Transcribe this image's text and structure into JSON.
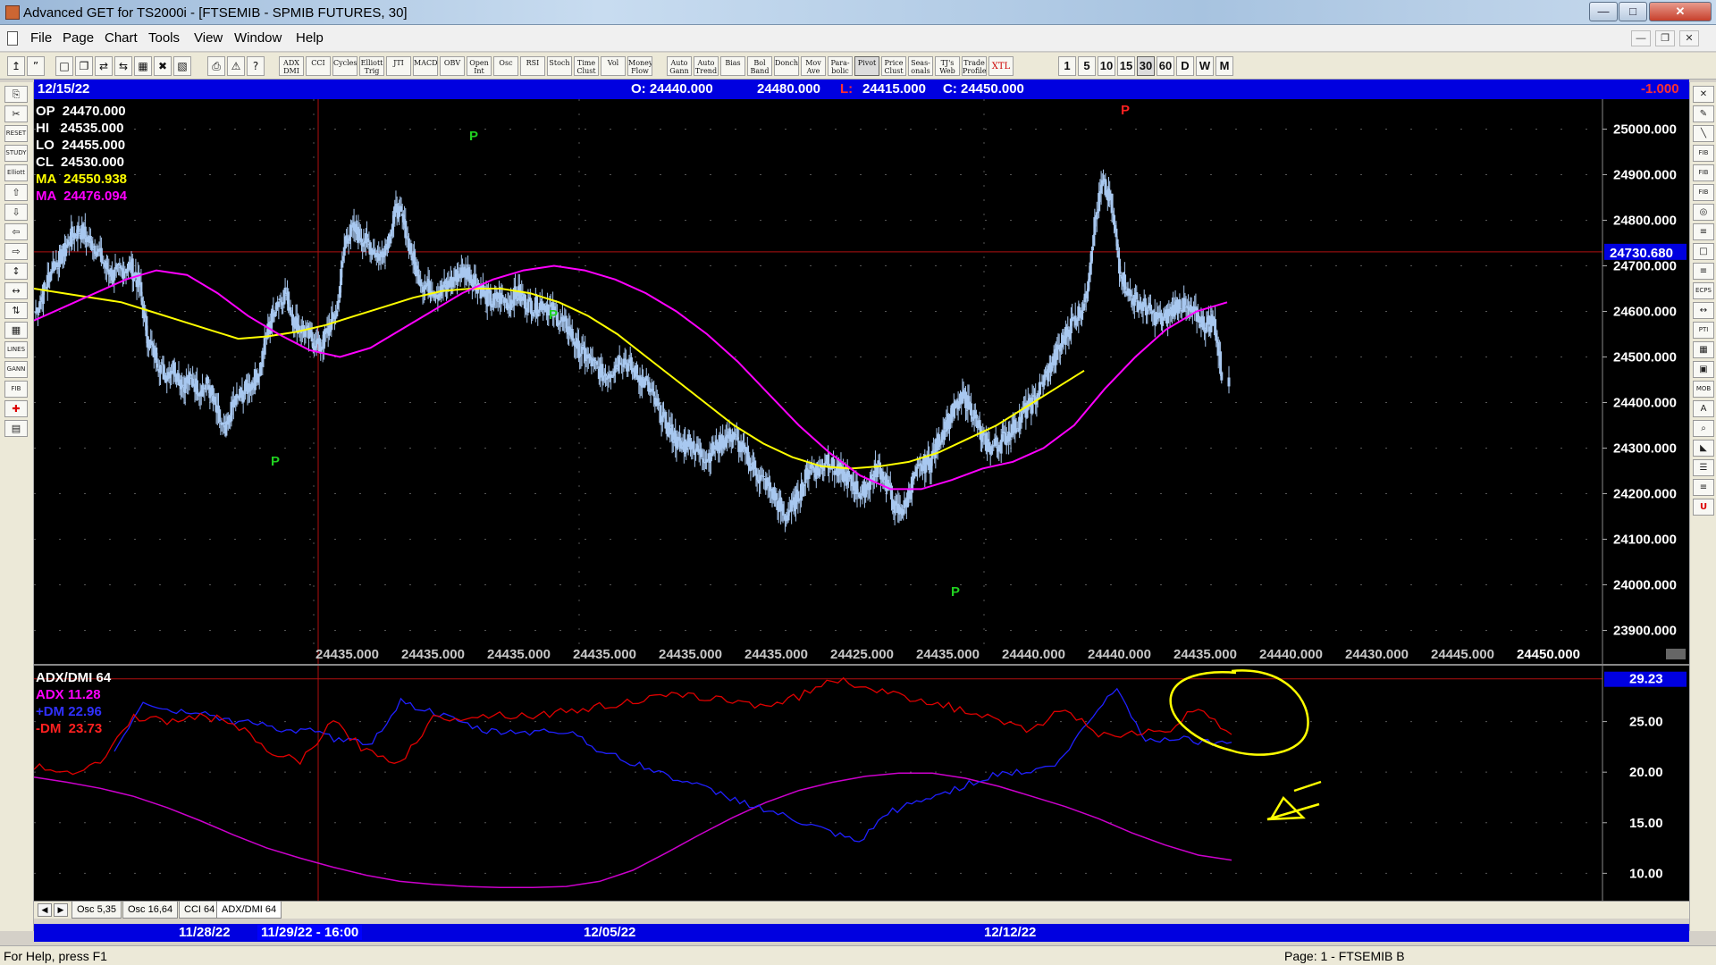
{
  "window": {
    "title": "Advanced GET for TS2000i - [FTSEMIB - SPMIB FUTURES, 30]",
    "controls": {
      "minimize": "—",
      "maximize": "□",
      "close": "✕"
    }
  },
  "menu": [
    "File",
    "Page",
    "Chart",
    "Tools",
    "View",
    "Window",
    "Help"
  ],
  "toolbar": {
    "study_buttons": [
      "ADX DMI",
      "CCI",
      "Cycles",
      "Elliott Trig",
      "JTI",
      "MACD",
      "OBV",
      "Open Int",
      "Osc",
      "RSI",
      "Stoch",
      "Time Clust",
      "Vol",
      "Money Flow",
      "Auto Gann",
      "Auto Trend",
      "Bias",
      "Bol Band",
      "Donch",
      "Mov Ave",
      "Para-bolic",
      "Pivot",
      "Price Clust",
      "Seas-onals",
      "TJ's Web",
      "Trade Profile",
      "XTL"
    ],
    "periods": [
      "1",
      "5",
      "10",
      "15",
      "30",
      "60",
      "D",
      "W",
      "M"
    ],
    "selected_period": "30"
  },
  "lefttools": [
    "",
    "",
    "RESET",
    "STUDY",
    "Elliott",
    "",
    "",
    "",
    "",
    "",
    "",
    "",
    "",
    "LINES",
    "GANN",
    "FIB",
    "",
    ""
  ],
  "righttools": [
    "",
    "",
    "",
    "FIB RET",
    "FIB EXT",
    "FIB TIME",
    "",
    "",
    "",
    "",
    "ECPS",
    "",
    "PTI",
    "",
    "",
    "MOB",
    "A",
    "",
    "",
    "",
    "",
    "U"
  ],
  "infobar": {
    "date": "12/15/22",
    "open": "O: 24440.000",
    "high": "24480.000",
    "low_label": "L:",
    "low": "24415.000",
    "close": "C: 24450.000",
    "change": "-1.000"
  },
  "price_readout": {
    "op": "OP  24470.000",
    "hi": "HI   24535.000",
    "lo": "LO  24455.000",
    "cl": "CL  24530.000",
    "ma1": "MA  24550.938",
    "ma2": "MA  24476.094"
  },
  "price_axis": {
    "labels": [
      "25000.000",
      "24900.000",
      "24800.000",
      "24700.000",
      "24600.000",
      "24500.000",
      "24400.000",
      "24300.000",
      "24200.000",
      "24100.000",
      "24000.000",
      "23900.000"
    ],
    "highlight": "24730.680"
  },
  "mid_values": [
    "24435.000",
    "24435.000",
    "24435.000",
    "24435.000",
    "24435.000",
    "24435.000",
    "24425.000",
    "24435.000",
    "24440.000",
    "24440.000",
    "24435.000",
    "24440.000",
    "24430.000",
    "24445.000",
    "24450.000"
  ],
  "pivot_label": "P",
  "osc_readout": {
    "title": "ADX/DMI 64",
    "adx": "ADX 11.28",
    "plus_dm": "+DM 22.96",
    "minus_dm": "-DM  23.73"
  },
  "osc_axis": {
    "labels": [
      "25.00",
      "20.00",
      "15.00",
      "10.00"
    ],
    "highlight": "29.23"
  },
  "tabs": [
    "Osc 5,35",
    "Osc 16,64",
    "CCI 64",
    "ADX/DMI 64"
  ],
  "active_tab": "ADX/DMI 64",
  "datebar": {
    "d1": "11/28/22",
    "cursor": "11/29/22 - 16:00",
    "d2": "12/05/22",
    "d3": "12/12/22"
  },
  "status": {
    "left": "For Help, press F1",
    "right": "Page: 1 - FTSEMIB B"
  },
  "colors": {
    "bar": "#a8c8f0",
    "ma_fast": "#ffff00",
    "ma_slow": "#ff00ff",
    "adx": "#cc00cc",
    "plus_dm": "#2020ff",
    "minus_dm": "#e00000",
    "pivot_high": "#ff2020",
    "pivot_low": "#20d020"
  },
  "chart_data": {
    "type": "candlestick",
    "title": "FTSEMIB - SPMIB FUTURES, 30",
    "ylim": [
      23850,
      25050
    ],
    "x_labels": [
      "11/28/22",
      "12/05/22",
      "12/12/22"
    ],
    "close_path": [
      24600,
      24650,
      24700,
      24720,
      24760,
      24780,
      24760,
      24740,
      24700,
      24680,
      24690,
      24700,
      24660,
      24540,
      24500,
      24460,
      24480,
      24440,
      24450,
      24430,
      24440,
      24380,
      24330,
      24400,
      24420,
      24440,
      24470,
      24560,
      24620,
      24640,
      24580,
      24560,
      24540,
      24520,
      24560,
      24600,
      24760,
      24780,
      24760,
      24740,
      24720,
      24760,
      24830,
      24780,
      24700,
      24660,
      24650,
      24640,
      24660,
      24680,
      24690,
      24670,
      24640,
      24620,
      24630,
      24620,
      24640,
      24620,
      24610,
      24620,
      24600,
      24580,
      24560,
      24520,
      24500,
      24480,
      24460,
      24470,
      24500,
      24480,
      24460,
      24440,
      24400,
      24360,
      24330,
      24300,
      24320,
      24290,
      24280,
      24300,
      24320,
      24330,
      24300,
      24270,
      24240,
      24220,
      24190,
      24150,
      24170,
      24210,
      24260,
      24250,
      24280,
      24250,
      24240,
      24220,
      24200,
      24230,
      24260,
      24220,
      24160,
      24170,
      24230,
      24260,
      24270,
      24320,
      24360,
      24390,
      24410,
      24380,
      24320,
      24300,
      24310,
      24330,
      24350,
      24380,
      24400,
      24440,
      24480,
      24520,
      24560,
      24590,
      24620,
      24780,
      24880,
      24840,
      24700,
      24640,
      24620,
      24610,
      24590,
      24580,
      24600,
      24620,
      24600,
      24590,
      24570,
      24580,
      24440
    ],
    "ma_fast": [
      24650,
      24640,
      24630,
      24620,
      24600,
      24580,
      24560,
      24540,
      24545,
      24555,
      24570,
      24590,
      24610,
      24630,
      24645,
      24650,
      24650,
      24640,
      24620,
      24590,
      24550,
      24500,
      24450,
      24400,
      24350,
      24310,
      24280,
      24260,
      24255,
      24260,
      24270,
      24290,
      24320,
      24350,
      24390,
      24430,
      24470
    ],
    "ma_slow": [
      24580,
      24610,
      24640,
      24670,
      24690,
      24680,
      24640,
      24590,
      24550,
      24515,
      24500,
      24520,
      24560,
      24600,
      24640,
      24670,
      24690,
      24700,
      24690,
      24670,
      24640,
      24600,
      24550,
      24490,
      24420,
      24350,
      24290,
      24240,
      24210,
      24210,
      24230,
      24255,
      24270,
      24300,
      24350,
      24430,
      24500,
      24560,
      24600,
      24620
    ],
    "pivots": [
      {
        "label": "P",
        "kind": "low"
      },
      {
        "label": "P",
        "kind": "high"
      },
      {
        "label": "P",
        "kind": "low"
      },
      {
        "label": "P",
        "kind": "low"
      },
      {
        "label": "P",
        "kind": "high"
      }
    ],
    "oscillator": {
      "name": "ADX/DMI 64",
      "ylim": [
        8,
        30
      ],
      "adx": [
        19.5,
        19.0,
        18.4,
        17.6,
        16.5,
        15.2,
        13.8,
        12.5,
        11.5,
        10.6,
        9.8,
        9.2,
        8.9,
        8.7,
        8.6,
        8.6,
        8.7,
        9.2,
        10.3,
        12.0,
        13.8,
        15.5,
        17.0,
        18.2,
        19.0,
        19.6,
        19.9,
        19.9,
        19.4,
        18.6,
        17.6,
        16.6,
        15.4,
        14.0,
        12.8,
        11.8,
        11.3
      ],
      "plus_dm": [
        22,
        27,
        26,
        26,
        25,
        25,
        24,
        24,
        23,
        23,
        27,
        26,
        25,
        24,
        24,
        24,
        24,
        22,
        21,
        20,
        19,
        18,
        17,
        16,
        15,
        14,
        13,
        16,
        17,
        18,
        19,
        20,
        20,
        21,
        25,
        28.5,
        23,
        23.5,
        23,
        22.96
      ],
      "minus_dm": [
        20.5,
        20,
        21,
        25.5,
        25,
        25.5,
        25,
        22,
        21,
        25,
        22,
        21,
        25.3,
        25.5,
        25.7,
        25.6,
        26,
        26.5,
        27,
        27.5,
        27.5,
        27,
        26.6,
        27.5,
        29.2,
        28.5,
        27.5,
        27,
        26,
        25,
        24,
        26.5,
        23.5,
        24,
        23.8,
        26.5,
        23.73
      ]
    }
  }
}
